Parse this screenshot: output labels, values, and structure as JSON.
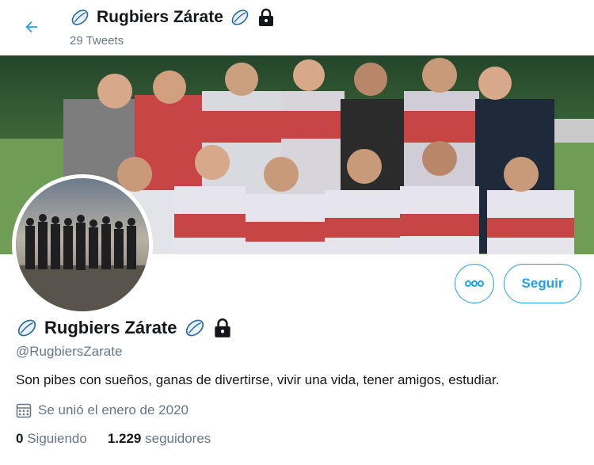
{
  "header": {
    "title": "Rugbiers Zárate",
    "tweet_count": "29 Tweets"
  },
  "profile": {
    "name": "Rugbiers Zárate",
    "handle": "@RugbiersZarate",
    "bio": "Son pibes con sueños, ganas de divertirse, vivir una vida, tener amigos, estudiar.",
    "joined": "Se unió el enero de 2020",
    "following_count": "0",
    "following_label": "Siguiendo",
    "followers_count": "1.229",
    "followers_label": "seguidores"
  },
  "actions": {
    "follow_label": "Seguir",
    "more_icon": "more-options-icon"
  },
  "icons": {
    "back": "arrow-left-icon",
    "rugby_ball": "rugby-ball-icon",
    "lock": "lock-icon",
    "calendar": "calendar-icon"
  },
  "colors": {
    "accent": "#1da1f2",
    "text": "#14171a",
    "secondary_text": "#657786"
  }
}
